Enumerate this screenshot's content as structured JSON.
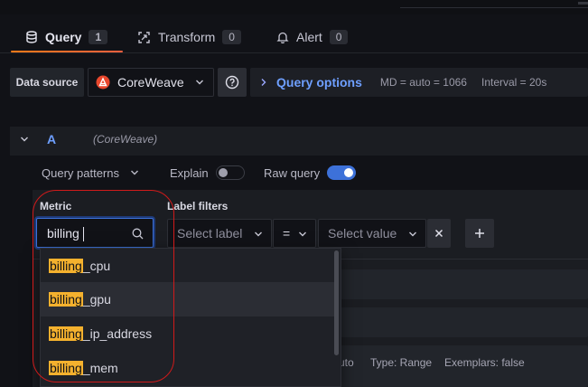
{
  "tabs": [
    {
      "label": "Query",
      "count": "1"
    },
    {
      "label": "Transform",
      "count": "0"
    },
    {
      "label": "Alert",
      "count": "0"
    }
  ],
  "datasource": {
    "label": "Data source",
    "selected": "CoreWeave",
    "query_options_label": "Query options",
    "md_info": "MD = auto = 1066",
    "interval_info": "Interval = 20s"
  },
  "query": {
    "letter": "A",
    "datasource_name": "(CoreWeave)",
    "patterns_label": "Query patterns",
    "explain_label": "Explain",
    "explain_on": false,
    "raw_label": "Raw query",
    "raw_on": true
  },
  "builder": {
    "metric_label": "Metric",
    "metric_value": "billing",
    "label_filters_label": "Label filters",
    "label_placeholder": "Select label",
    "operator": "=",
    "value_placeholder": "Select value"
  },
  "dropdown": {
    "highlight": "billing",
    "items": [
      {
        "match": "billing",
        "rest": "_cpu"
      },
      {
        "match": "billing",
        "rest": "_gpu"
      },
      {
        "match": "billing",
        "rest": "_ip_address"
      },
      {
        "match": "billing",
        "rest": "_mem"
      }
    ]
  },
  "status": {
    "partial_auto": "uto",
    "type": "Type: Range",
    "exemplars": "Exemplars: false"
  },
  "colors": {
    "accent_blue": "#6e9fff",
    "toggle_on": "#3d71d9",
    "highlight": "#f4b12e",
    "annotation": "#d11a1a",
    "tab_underline": "#ff7a18"
  }
}
